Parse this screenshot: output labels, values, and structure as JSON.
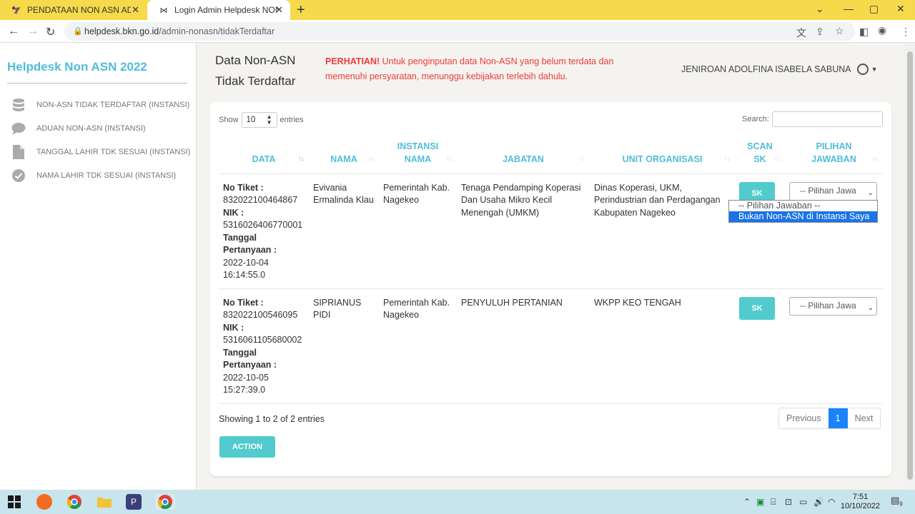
{
  "browser": {
    "tabs": [
      {
        "title": "PENDATAAN NON ASN ADMIN",
        "active": false
      },
      {
        "title": "Login Admin Helpdesk NON ASN",
        "active": true
      }
    ],
    "url_host": "helpdesk.bkn.go.id",
    "url_path": "/admin-nonasn/tidakTerdaftar"
  },
  "sidebar": {
    "brand": "Helpdesk Non ASN 2022",
    "items": [
      {
        "label": "NON-ASN TIDAK TERDAFTAR (INSTANSI)",
        "icon": "database-icon"
      },
      {
        "label": "ADUAN NON-ASN (INSTANSI)",
        "icon": "chat-bubble-icon"
      },
      {
        "label": "TANGGAL LAHIR TDK SESUAI (INSTANSI)",
        "icon": "document-icon"
      },
      {
        "label": "NAMA LAHIR TDK SESUAI (INSTANSI)",
        "icon": "check-circle-icon"
      }
    ]
  },
  "header": {
    "title_line1": "Data Non-ASN",
    "title_line2": "Tidak Terdaftar",
    "notice_bold": "PERHATIAN!",
    "notice_text": " Untuk penginputan data Non-ASN yang belum terdata dan memenuhi persyaratan, menunggu kebijakan terlebih dahulu.",
    "user_name": "JENIROAN ADOLFINA ISABELA SABUNA"
  },
  "table_controls": {
    "show_label": "Show",
    "entries_value": "10",
    "entries_label": "entries",
    "search_label": "Search:"
  },
  "table": {
    "columns": [
      "DATA",
      "NAMA",
      "INSTANSI NAMA",
      "JABATAN",
      "UNIT ORGANISASI",
      "SCAN SK",
      "PILIHAN JAWABAN"
    ],
    "rows": [
      {
        "no_tiket_label": "No Tiket :",
        "no_tiket": "832022100464867",
        "nik_label": "NIK :",
        "nik": "5316026406770001",
        "tanggal_label1": "Tanggal",
        "tanggal_label2": "Pertanyaan :",
        "tanggal_date": "2022-10-04",
        "tanggal_time": "16:14:55.0",
        "nama": "Evivania Ermalinda Klau",
        "instansi": "Pemerintah Kab. Nagekeo",
        "jabatan": "Tenaga Pendamping Koperasi Dan Usaha Mikro Kecil Menengah (UMKM)",
        "unit": "Dinas Koperasi, UKM, Perindustrian dan Perdagangan Kabupaten Nagekeo",
        "sk_label": "SK",
        "pilihan": "-- Pilihan Jawa"
      },
      {
        "no_tiket_label": "No Tiket :",
        "no_tiket": "832022100546095",
        "nik_label": "NIK :",
        "nik": "5316061105680002",
        "tanggal_label1": "Tanggal",
        "tanggal_label2": "Pertanyaan :",
        "tanggal_date": "2022-10-05",
        "tanggal_time": "15:27:39.0",
        "nama": "SIPRIANUS PIDI",
        "instansi": "Pemerintah Kab. Nagekeo",
        "jabatan": "PENYULUH PERTANIAN",
        "unit": "WKPP KEO TENGAH",
        "sk_label": "SK",
        "pilihan": "-- Pilihan Jawa"
      }
    ]
  },
  "dropdown": {
    "options": [
      "-- Pilihan Jawaban --",
      "Bukan Non-ASN di Instansi Saya"
    ],
    "highlighted_index": 1
  },
  "footer": {
    "info": "Showing 1 to 2 of 2 entries",
    "previous": "Previous",
    "current_page": "1",
    "next": "Next",
    "action": "ACTION"
  },
  "taskbar": {
    "time": "7:51",
    "date": "10/10/2022",
    "notification_count": "9"
  },
  "colors": {
    "accent": "#51bcda",
    "button": "#51cbce",
    "notice": "#ef3b3b",
    "tabbar": "#f7d94c"
  }
}
